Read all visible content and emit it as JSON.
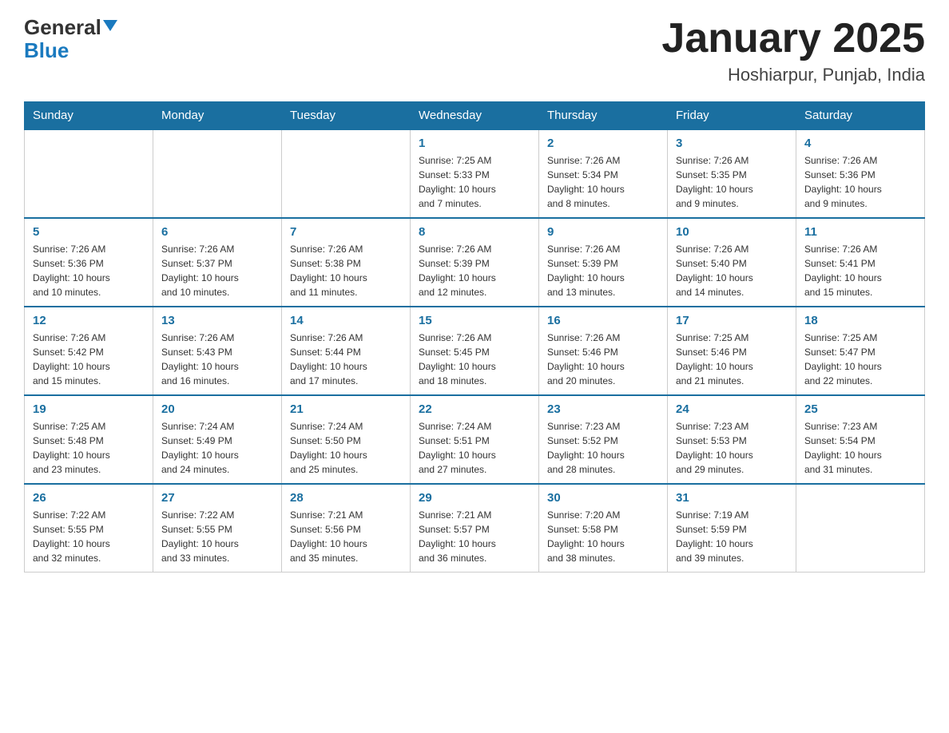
{
  "header": {
    "logo_general": "General",
    "logo_blue": "Blue",
    "month_title": "January 2025",
    "location": "Hoshiarpur, Punjab, India"
  },
  "weekdays": [
    "Sunday",
    "Monday",
    "Tuesday",
    "Wednesday",
    "Thursday",
    "Friday",
    "Saturday"
  ],
  "weeks": [
    [
      {
        "day": "",
        "info": ""
      },
      {
        "day": "",
        "info": ""
      },
      {
        "day": "",
        "info": ""
      },
      {
        "day": "1",
        "info": "Sunrise: 7:25 AM\nSunset: 5:33 PM\nDaylight: 10 hours\nand 7 minutes."
      },
      {
        "day": "2",
        "info": "Sunrise: 7:26 AM\nSunset: 5:34 PM\nDaylight: 10 hours\nand 8 minutes."
      },
      {
        "day": "3",
        "info": "Sunrise: 7:26 AM\nSunset: 5:35 PM\nDaylight: 10 hours\nand 9 minutes."
      },
      {
        "day": "4",
        "info": "Sunrise: 7:26 AM\nSunset: 5:36 PM\nDaylight: 10 hours\nand 9 minutes."
      }
    ],
    [
      {
        "day": "5",
        "info": "Sunrise: 7:26 AM\nSunset: 5:36 PM\nDaylight: 10 hours\nand 10 minutes."
      },
      {
        "day": "6",
        "info": "Sunrise: 7:26 AM\nSunset: 5:37 PM\nDaylight: 10 hours\nand 10 minutes."
      },
      {
        "day": "7",
        "info": "Sunrise: 7:26 AM\nSunset: 5:38 PM\nDaylight: 10 hours\nand 11 minutes."
      },
      {
        "day": "8",
        "info": "Sunrise: 7:26 AM\nSunset: 5:39 PM\nDaylight: 10 hours\nand 12 minutes."
      },
      {
        "day": "9",
        "info": "Sunrise: 7:26 AM\nSunset: 5:39 PM\nDaylight: 10 hours\nand 13 minutes."
      },
      {
        "day": "10",
        "info": "Sunrise: 7:26 AM\nSunset: 5:40 PM\nDaylight: 10 hours\nand 14 minutes."
      },
      {
        "day": "11",
        "info": "Sunrise: 7:26 AM\nSunset: 5:41 PM\nDaylight: 10 hours\nand 15 minutes."
      }
    ],
    [
      {
        "day": "12",
        "info": "Sunrise: 7:26 AM\nSunset: 5:42 PM\nDaylight: 10 hours\nand 15 minutes."
      },
      {
        "day": "13",
        "info": "Sunrise: 7:26 AM\nSunset: 5:43 PM\nDaylight: 10 hours\nand 16 minutes."
      },
      {
        "day": "14",
        "info": "Sunrise: 7:26 AM\nSunset: 5:44 PM\nDaylight: 10 hours\nand 17 minutes."
      },
      {
        "day": "15",
        "info": "Sunrise: 7:26 AM\nSunset: 5:45 PM\nDaylight: 10 hours\nand 18 minutes."
      },
      {
        "day": "16",
        "info": "Sunrise: 7:26 AM\nSunset: 5:46 PM\nDaylight: 10 hours\nand 20 minutes."
      },
      {
        "day": "17",
        "info": "Sunrise: 7:25 AM\nSunset: 5:46 PM\nDaylight: 10 hours\nand 21 minutes."
      },
      {
        "day": "18",
        "info": "Sunrise: 7:25 AM\nSunset: 5:47 PM\nDaylight: 10 hours\nand 22 minutes."
      }
    ],
    [
      {
        "day": "19",
        "info": "Sunrise: 7:25 AM\nSunset: 5:48 PM\nDaylight: 10 hours\nand 23 minutes."
      },
      {
        "day": "20",
        "info": "Sunrise: 7:24 AM\nSunset: 5:49 PM\nDaylight: 10 hours\nand 24 minutes."
      },
      {
        "day": "21",
        "info": "Sunrise: 7:24 AM\nSunset: 5:50 PM\nDaylight: 10 hours\nand 25 minutes."
      },
      {
        "day": "22",
        "info": "Sunrise: 7:24 AM\nSunset: 5:51 PM\nDaylight: 10 hours\nand 27 minutes."
      },
      {
        "day": "23",
        "info": "Sunrise: 7:23 AM\nSunset: 5:52 PM\nDaylight: 10 hours\nand 28 minutes."
      },
      {
        "day": "24",
        "info": "Sunrise: 7:23 AM\nSunset: 5:53 PM\nDaylight: 10 hours\nand 29 minutes."
      },
      {
        "day": "25",
        "info": "Sunrise: 7:23 AM\nSunset: 5:54 PM\nDaylight: 10 hours\nand 31 minutes."
      }
    ],
    [
      {
        "day": "26",
        "info": "Sunrise: 7:22 AM\nSunset: 5:55 PM\nDaylight: 10 hours\nand 32 minutes."
      },
      {
        "day": "27",
        "info": "Sunrise: 7:22 AM\nSunset: 5:55 PM\nDaylight: 10 hours\nand 33 minutes."
      },
      {
        "day": "28",
        "info": "Sunrise: 7:21 AM\nSunset: 5:56 PM\nDaylight: 10 hours\nand 35 minutes."
      },
      {
        "day": "29",
        "info": "Sunrise: 7:21 AM\nSunset: 5:57 PM\nDaylight: 10 hours\nand 36 minutes."
      },
      {
        "day": "30",
        "info": "Sunrise: 7:20 AM\nSunset: 5:58 PM\nDaylight: 10 hours\nand 38 minutes."
      },
      {
        "day": "31",
        "info": "Sunrise: 7:19 AM\nSunset: 5:59 PM\nDaylight: 10 hours\nand 39 minutes."
      },
      {
        "day": "",
        "info": ""
      }
    ]
  ]
}
